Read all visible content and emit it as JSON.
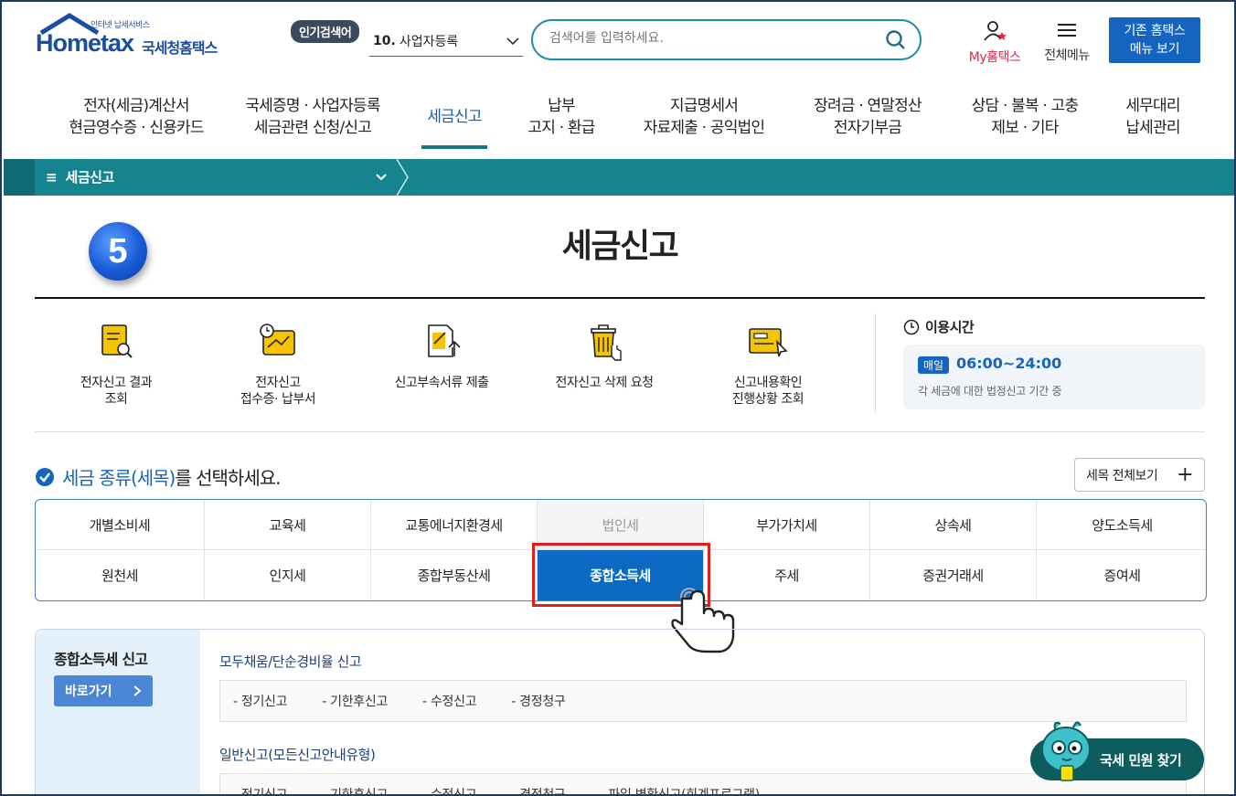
{
  "header": {
    "logo_small": "인터넷 납세서비스",
    "logo_main": "Hometax",
    "logo_sub": "국세청홈택스",
    "popular_badge": "인기검색어",
    "popular_rank": "10.",
    "popular_term": "사업자등록",
    "search_placeholder": "검색어를 입력하세요.",
    "my_hometax": "My홈택스",
    "all_menu": "전체메뉴",
    "old_menu_line1": "기존 홈택스",
    "old_menu_line2": "메뉴 보기"
  },
  "gnb": [
    {
      "line1": "전자(세금)계산서",
      "line2": "현금영수증 · 신용카드"
    },
    {
      "line1": "국세증명 · 사업자등록",
      "line2": "세금관련 신청/신고"
    },
    {
      "line1": "세금신고",
      "line2": ""
    },
    {
      "line1": "납부",
      "line2": "고지 · 환급"
    },
    {
      "line1": "지급명세서",
      "line2": "자료제출 · 공익법인"
    },
    {
      "line1": "장려금 · 연말정산",
      "line2": "전자기부금"
    },
    {
      "line1": "상담 · 불복 · 고충",
      "line2": "제보 · 기타"
    },
    {
      "line1": "세무대리",
      "line2": "납세관리"
    }
  ],
  "subbar": {
    "crumb": "세금신고"
  },
  "step_number": "5",
  "page_title": "세금신고",
  "quick_links": [
    {
      "label": "전자신고 결과\n조회",
      "icon": "document-search-icon"
    },
    {
      "label": "전자신고\n접수증· 납부서",
      "icon": "receipt-clock-icon"
    },
    {
      "label": "신고부속서류 제출",
      "icon": "document-upload-icon"
    },
    {
      "label": "전자신고 삭제 요청",
      "icon": "trash-icon"
    },
    {
      "label": "신고내용확인\n진행상황 조회",
      "icon": "progress-check-icon"
    }
  ],
  "usage": {
    "title": "이용시간",
    "badge": "매일",
    "hours": "06:00~24:00",
    "note": "각 세금에 대한 법정신고 기간 중"
  },
  "select_heading": {
    "highlight": "세금 종류(세목)",
    "rest": "를 선택하세요."
  },
  "see_all": "세목 전체보기",
  "tax_types": [
    [
      "개별소비세",
      "교육세",
      "교통에너지환경세",
      "법인세",
      "부가가치세",
      "상속세",
      "양도소득세"
    ],
    [
      "원천세",
      "인지세",
      "종합부동산세",
      "종합소득세",
      "주세",
      "증권거래세",
      "증여세"
    ]
  ],
  "selected_tax": "종합소득세",
  "disabled_tax": "법인세",
  "panel": {
    "title": "종합소득세 신고",
    "goto": "바로가기",
    "sections": [
      {
        "title": "모두채움/단순경비율 신고",
        "items": [
          "- 정기신고",
          "- 기한후신고",
          "- 수정신고",
          "- 경정청구"
        ]
      },
      {
        "title": "일반신고(모든신고안내유형)",
        "items": [
          "- 정기신고",
          "- 기한후신고",
          "- 수정신고",
          "- 경정청구",
          "- 파일 변환신고(회계프로그램)"
        ]
      }
    ]
  },
  "civil_button": "국세 민원 찾기",
  "colors": {
    "accent": "#1565c0",
    "teal": "#16848e",
    "selected": "#0d6ac4",
    "highlight_box": "#e01e1e"
  }
}
